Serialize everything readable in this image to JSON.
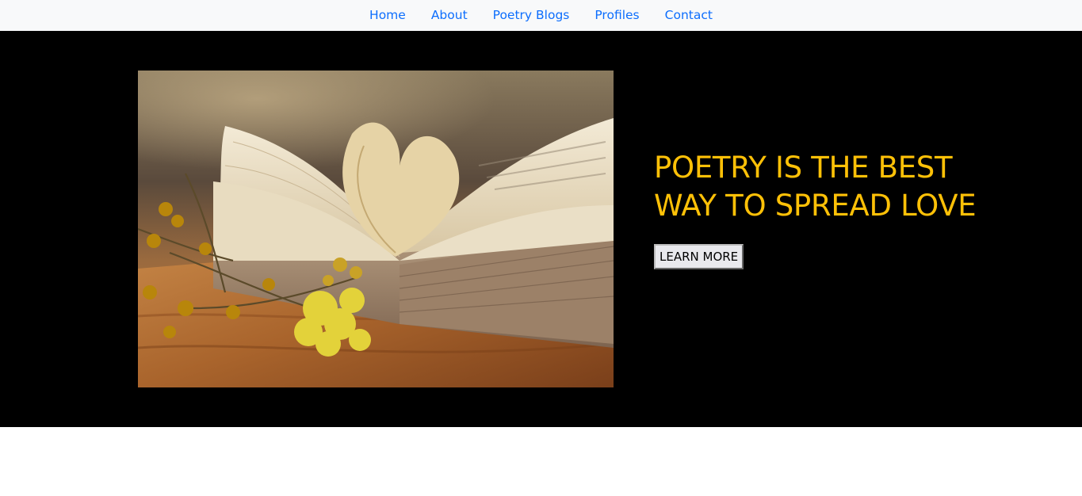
{
  "nav": {
    "items": [
      {
        "label": "Home"
      },
      {
        "label": "About"
      },
      {
        "label": "Poetry Blogs"
      },
      {
        "label": "Profiles"
      },
      {
        "label": "Contact"
      }
    ],
    "link_color": "#0d6efd",
    "background": "#f8f9fa"
  },
  "hero": {
    "heading": "POETRY IS THE BEST WAY TO SPREAD LOVE",
    "button_label": "LEARN MORE",
    "heading_color": "#ffc107",
    "background": "#000000",
    "image_icon": "open-book-heart-pages-with-yellow-flowers"
  }
}
